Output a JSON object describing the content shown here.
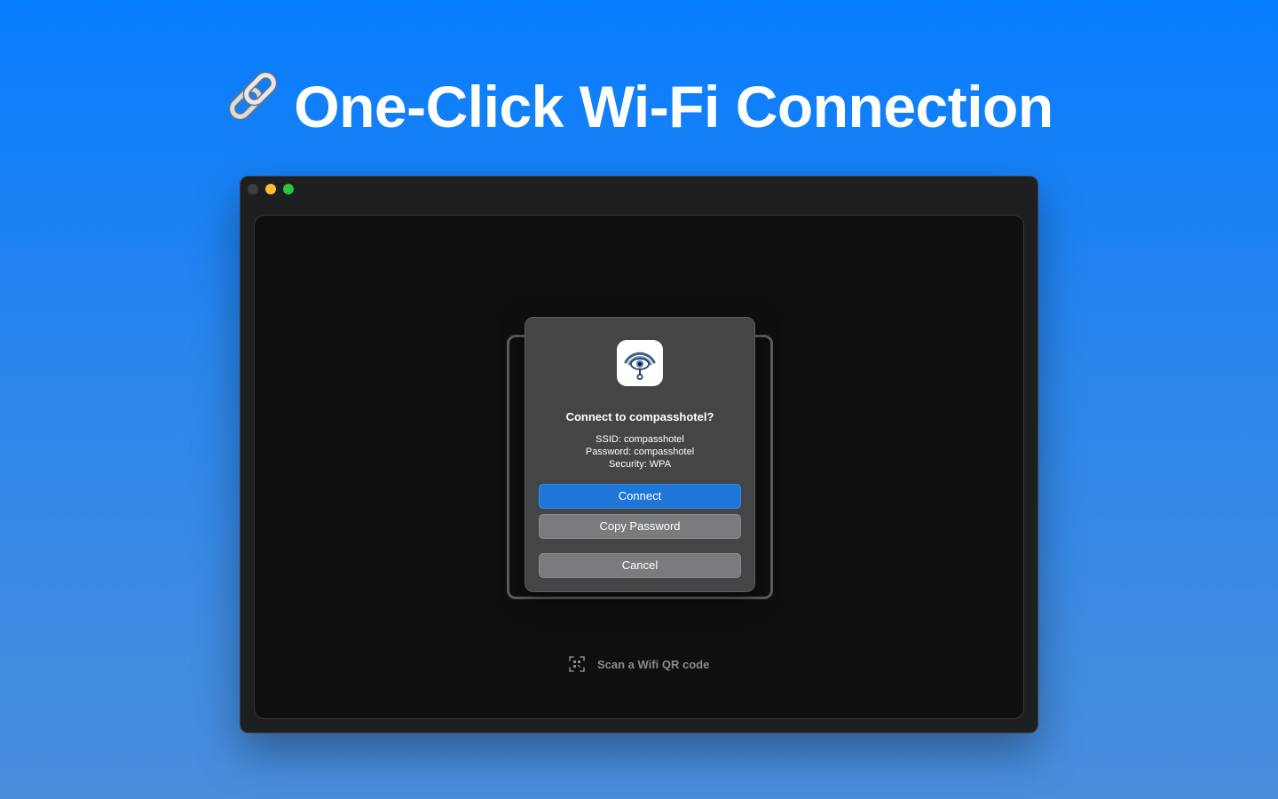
{
  "headline": {
    "icon": "link-icon",
    "text": "One-Click Wi-Fi Connection"
  },
  "window": {
    "traffic_lights": [
      "close",
      "minimize",
      "zoom"
    ],
    "colors": {
      "close": "#3e3f42",
      "minimize": "#fdbd2e",
      "zoom": "#27c840"
    }
  },
  "dialog": {
    "app_icon": "wifi-eye-app-icon",
    "title": "Connect to compasshotel?",
    "ssid_line": "SSID: compasshotel",
    "password_line": "Password: compasshotel",
    "security_line": "Security: WPA",
    "buttons": {
      "connect": "Connect",
      "copy_password": "Copy Password",
      "cancel": "Cancel"
    },
    "accent_color": "#1f76d9"
  },
  "scan": {
    "icon": "qr-code-scan-icon",
    "label": "Scan a Wifi QR code"
  }
}
